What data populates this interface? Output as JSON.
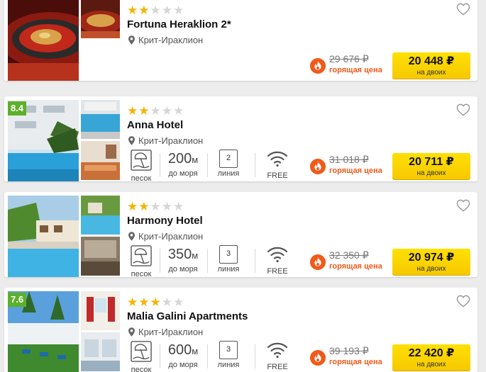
{
  "hotels": [
    {
      "stars": 2,
      "name": "Fortuna Heraklion 2*",
      "location": "Крит-Ираклион",
      "rating": "",
      "old_price": "29 676 ₽",
      "hot_label": "горящая цена",
      "price": "20 448 ₽",
      "price_sub": "на двоих"
    },
    {
      "stars": 2,
      "name": "Anna Hotel",
      "location": "Крит-Ираклион",
      "rating": "8.4",
      "beach": "песок",
      "distance_value": "200",
      "distance_unit": "м",
      "distance_label": "до моря",
      "line_value": "2",
      "line_label": "линия",
      "wifi_label": "FREE",
      "old_price": "31 018 ₽",
      "hot_label": "горящая цена",
      "price": "20 711 ₽",
      "price_sub": "на двоих"
    },
    {
      "stars": 2,
      "name": "Harmony Hotel",
      "location": "Крит-Ираклион",
      "rating": "",
      "beach": "песок",
      "distance_value": "350",
      "distance_unit": "м",
      "distance_label": "до моря",
      "line_value": "3",
      "line_label": "линия",
      "wifi_label": "FREE",
      "old_price": "32 350 ₽",
      "hot_label": "горящая цена",
      "price": "20 974 ₽",
      "price_sub": "на двоих"
    },
    {
      "stars": 3,
      "name": "Malia Galini Apartments",
      "location": "Крит-Ираклион",
      "rating": "7.6",
      "beach": "песок",
      "distance_value": "600",
      "distance_unit": "м",
      "distance_label": "до моря",
      "line_value": "3",
      "line_label": "линия",
      "wifi_label": "FREE",
      "old_price": "39 193 ₽",
      "hot_label": "горящая цена",
      "price": "22 420 ₽",
      "price_sub": "на двоих"
    }
  ],
  "icons": {
    "location": "pin-icon",
    "favorite": "heart-icon",
    "hot": "flame-icon",
    "beach": "beach-umbrella-icon",
    "wifi": "wifi-icon"
  },
  "colors": {
    "price_button": "#ffd600",
    "hot": "#f05a1a",
    "rating": "#5cb02a",
    "star_on": "#f5b400",
    "star_off": "#d6d6d6"
  }
}
